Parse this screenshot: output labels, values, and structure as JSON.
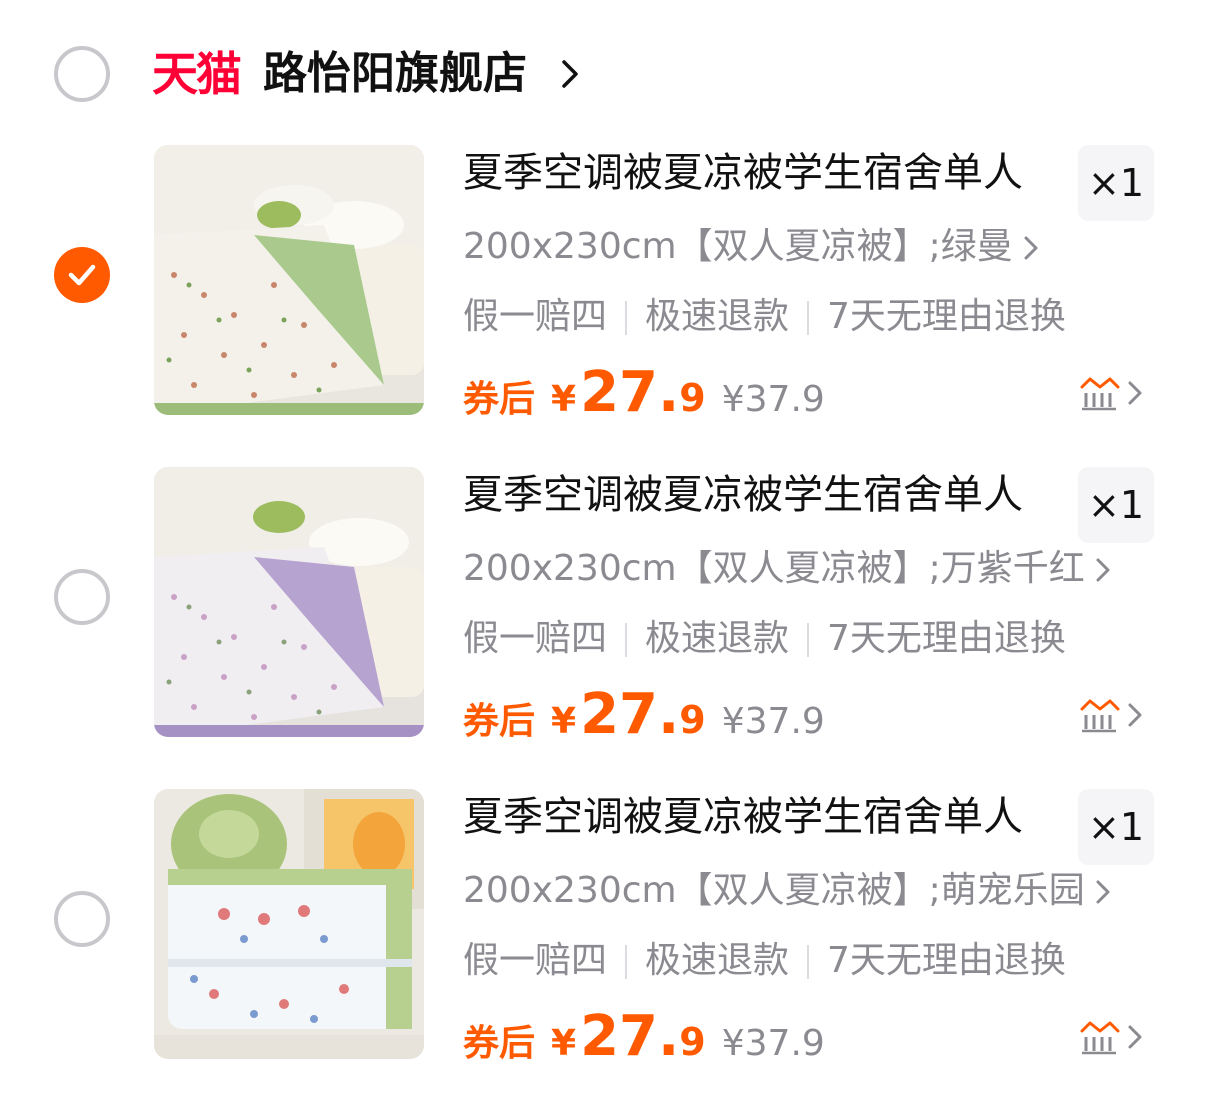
{
  "shop": {
    "platform_logo": "天猫",
    "name": "路怡阳旗舰店",
    "selected": false
  },
  "colors": {
    "accent": "#ff5a00",
    "tmall": "#ff0036",
    "muted_text": "#8a8a90"
  },
  "items": [
    {
      "selected": true,
      "title": "夏季空调被夏凉被学生宿舍单人",
      "quantity": "×1",
      "sku": "200x230cm【双人夏凉被】;绿曼",
      "services": [
        "假一赔四",
        "极速退款",
        "7天无理由退换"
      ],
      "coupon_label": "券后",
      "currency": "¥",
      "price_int": "27.",
      "price_dec": "9",
      "original_price": "¥37.9",
      "accent_color": "#8fb56a"
    },
    {
      "selected": false,
      "title": "夏季空调被夏凉被学生宿舍单人",
      "quantity": "×1",
      "sku": "200x230cm【双人夏凉被】;万紫千红",
      "services": [
        "假一赔四",
        "极速退款",
        "7天无理由退换"
      ],
      "coupon_label": "券后",
      "currency": "¥",
      "price_int": "27.",
      "price_dec": "9",
      "original_price": "¥37.9",
      "accent_color": "#a691c4"
    },
    {
      "selected": false,
      "title": "夏季空调被夏凉被学生宿舍单人",
      "quantity": "×1",
      "sku": "200x230cm【双人夏凉被】;萌宠乐园",
      "services": [
        "假一赔四",
        "极速退款",
        "7天无理由退换"
      ],
      "coupon_label": "券后",
      "currency": "¥",
      "price_int": "27.",
      "price_dec": "9",
      "original_price": "¥37.9",
      "accent_color": "#9cc07a"
    }
  ]
}
